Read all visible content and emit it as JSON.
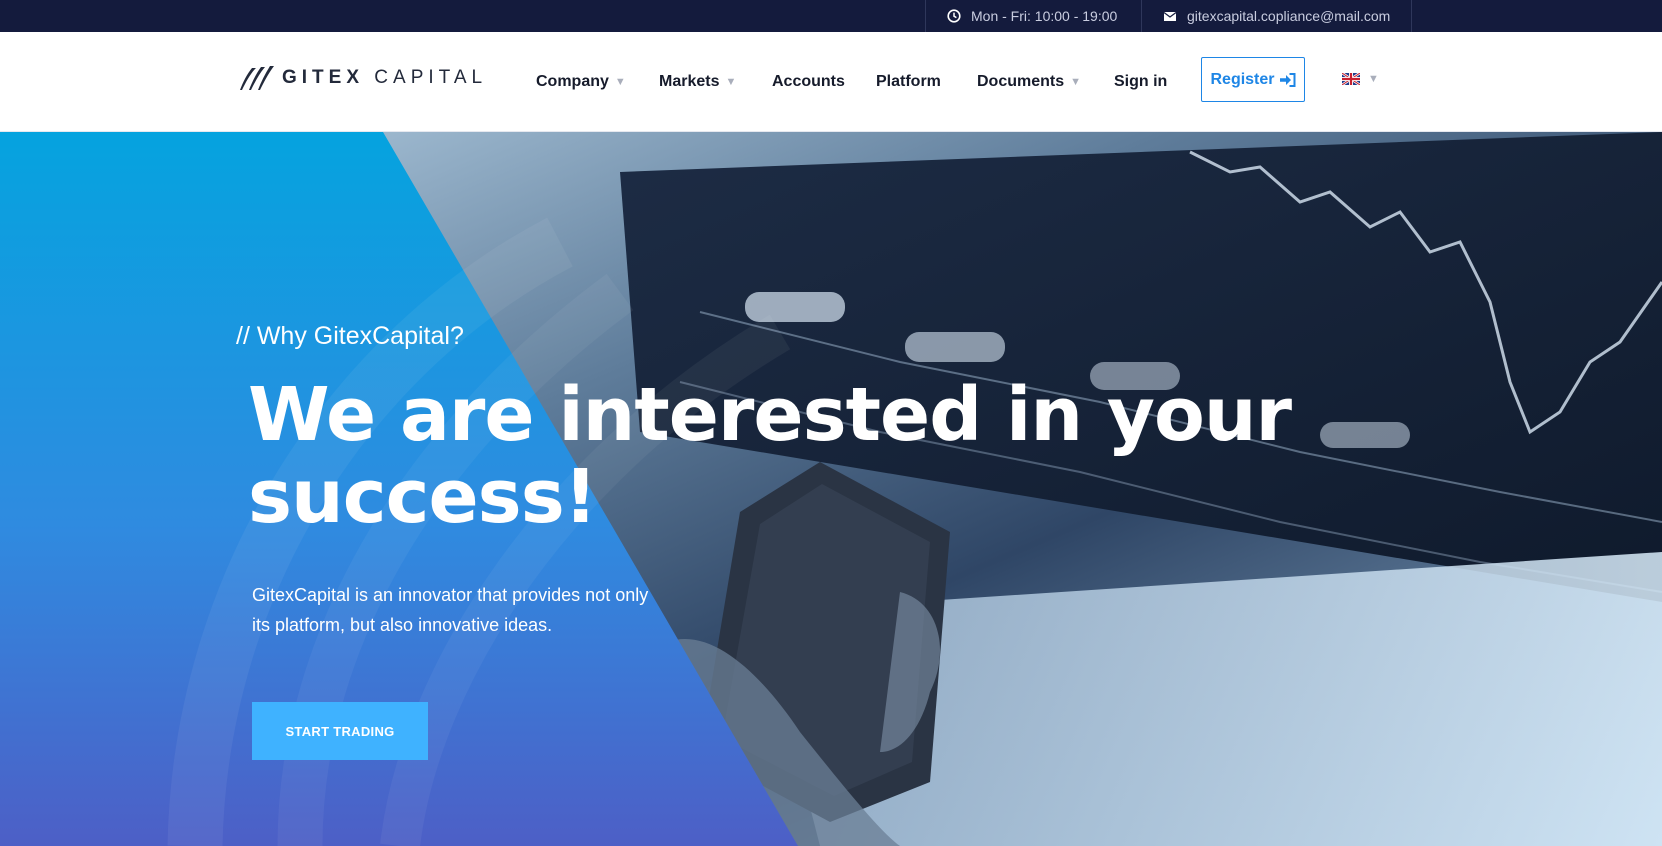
{
  "topbar": {
    "hours": "Mon - Fri: 10:00 - 19:00",
    "email": "gitexcapital.copliance@mail.com",
    "hours_icon": "clock-icon",
    "email_icon": "envelope-icon"
  },
  "header": {
    "logo": {
      "brand_bold": "GITEX",
      "brand_light": "CAPITAL",
      "icon": "logo-mark-icon"
    },
    "nav": [
      {
        "label": "Company",
        "dropdown": true
      },
      {
        "label": "Markets",
        "dropdown": true
      },
      {
        "label": "Accounts",
        "dropdown": false
      },
      {
        "label": "Platform",
        "dropdown": false
      },
      {
        "label": "Documents",
        "dropdown": true
      },
      {
        "label": "Sign in",
        "dropdown": false
      }
    ],
    "caret": "▼",
    "register_label": "Register",
    "register_icon": "sign-in-icon",
    "language_icon": "uk-flag-icon",
    "accent_color": "#1e86e6"
  },
  "hero": {
    "eyebrow": "// Why GitexCapital?",
    "headline_line1": "We are interested in your",
    "headline_line2": "success!",
    "subtext": "GitexCapital is an innovator that provides not only its platform, but also innovative ideas.",
    "cta_label": "START TRADING",
    "cta_color": "#3fb2ff"
  }
}
